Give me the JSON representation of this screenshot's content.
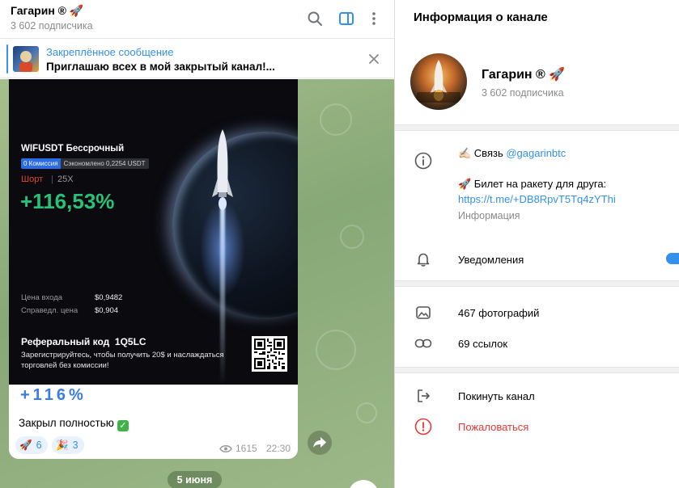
{
  "chat": {
    "title": "Гагарин ® 🚀",
    "subscribers": "3 602 подписчика",
    "pinned_title": "Закреплённое сообщение",
    "pinned_text": "Приглашаю всех в мой закрытый канал!..."
  },
  "post": {
    "image": {
      "pair": "WIFUSDT Бессрочный",
      "badge_fee": "0 Комиссия",
      "badge_saved": "Сэкономлено 0,2254 USDT",
      "side": "Шорт",
      "separator": "|",
      "leverage": "25X",
      "percent": "+116,53%",
      "entry_label": "Цена входа",
      "entry_value": "$0,9482",
      "fair_label": "Справедл. цена",
      "fair_value": "$0,904",
      "ref_label": "Реферальный код",
      "ref_code": "1Q5LC",
      "register_text": "Зарегистрируйтесь, чтобы получить 20$ и наслаждаться торговлей без комиссии!"
    },
    "big_percent": "+116%",
    "closed_text": "Закрыл полностью",
    "reactions": [
      {
        "emoji": "🚀",
        "count": "6"
      },
      {
        "emoji": "🎉",
        "count": "3"
      }
    ],
    "views": "1615",
    "time": "22:30"
  },
  "date_pill": "5 июня",
  "info_panel": {
    "title": "Информация о канале",
    "name": "Гагарин ® 🚀",
    "subscribers": "3 602 подписчика",
    "contact_prefix": "✍🏻 Связь",
    "contact_handle": "@gagarinbtc",
    "ticket_text": "🚀 Билет на ракету для друга:",
    "ticket_link": "https://t.me/+DB8RpvT5Tq4zYThi",
    "info_label": "Информация",
    "notifications": "Уведомления",
    "photos": "467 фотографий",
    "links": "69 ссылок",
    "leave": "Покинуть канал",
    "report": "Пожаловаться"
  },
  "colors": {
    "accent": "#3390ec",
    "danger": "#e53935",
    "profit": "#27c27a"
  }
}
